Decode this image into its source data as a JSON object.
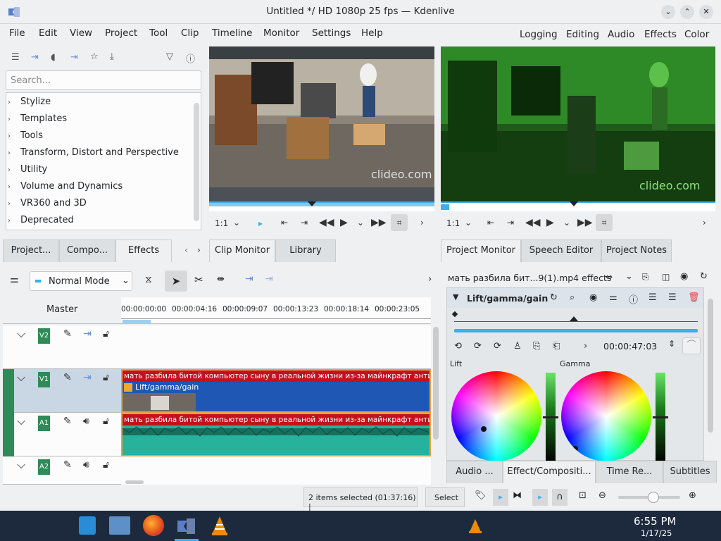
{
  "window": {
    "title": "Untitled */ HD 1080p 25 fps — Kdenlive"
  },
  "menu": [
    "File",
    "Edit",
    "View",
    "Project",
    "Tool",
    "Clip",
    "Timeline",
    "Monitor",
    "Settings",
    "Help"
  ],
  "workspaces": [
    "Logging",
    "Editing",
    "Audio",
    "Effects",
    "Color"
  ],
  "effects_panel": {
    "search_placeholder": "Search...",
    "items": [
      "Stylize",
      "Templates",
      "Tools",
      "Transform, Distort and Perspective",
      "Utility",
      "Volume and Dynamics",
      "VR360 and 3D",
      "Deprecated"
    ]
  },
  "left_tabs": [
    "Project...",
    "Compo...",
    "Effects"
  ],
  "monitor_tabs_left": [
    "Clip Monitor",
    "Library"
  ],
  "monitor_tabs_right": [
    "Project Monitor",
    "Speech Editor",
    "Project Notes"
  ],
  "clip_monitor": {
    "zoom": "1:1",
    "watermark": "clideo.com"
  },
  "project_monitor": {
    "zoom": "1:1",
    "watermark": "clideo.com"
  },
  "timeline_toolbar": {
    "mode": "Normal Mode"
  },
  "timeline": {
    "master_label": "Master",
    "ruler": [
      "00:00:00:00",
      "00:00:04:16",
      "00:00:09:07",
      "00:00:13:23",
      "00:00:18:14",
      "00:00:23:05"
    ],
    "tracks": [
      "V2",
      "V1",
      "A1",
      "A2"
    ],
    "clip_title": "мать разбила битой компьютер сыну в реальной жизни из-за майнкрафт анти-гр",
    "clip_effect": "Lift/gamma/gain"
  },
  "effect_stack": {
    "header": "мать разбила бит...9(1).mp4 effects",
    "effect_name": "Lift/gamma/gain",
    "timecode": "00:00:47:03",
    "lift_label": "Lift",
    "gamma_label": "Gamma"
  },
  "bottom_right_tabs": [
    "Audio ...",
    "Effect/Compositi...",
    "Time Re...",
    "Subtitles"
  ],
  "status": {
    "selection": "2 items selected (01:37:16) |",
    "select_label": "Select"
  },
  "clock": {
    "time": "6:55 PM",
    "date": "1/17/25"
  },
  "colors": {
    "accent": "#3daee9",
    "video_clip": "#1f57b5",
    "audio_clip": "#26b29b",
    "clip_title_bar": "#c3121c",
    "track_label": "#2e8b57"
  }
}
